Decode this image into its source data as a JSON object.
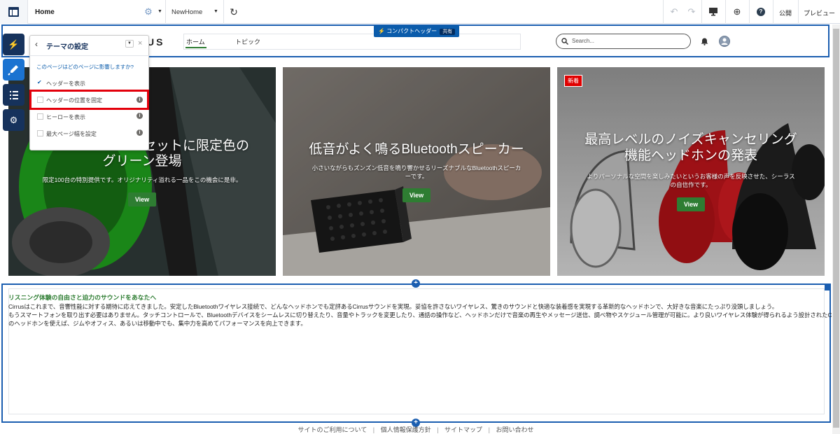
{
  "topbar": {
    "page_name": "Home",
    "page_select": "NewHome",
    "publish": "公開",
    "preview": "プレビュー"
  },
  "header_badge": {
    "label": "コンパクトヘッダー",
    "tag": "共有"
  },
  "site_header": {
    "logo_partial": "US",
    "nav": [
      "ホーム",
      "トピック"
    ],
    "search_placeholder": "Search..."
  },
  "theme_panel": {
    "title": "テーマの設定",
    "question": "このページはどのページに影響しますか?",
    "options": [
      {
        "label": "ヘッダーを表示",
        "checked": true
      },
      {
        "label": "ヘッダーの位置を固定",
        "checked": false
      },
      {
        "label": "ヒーローを表示",
        "checked": false
      },
      {
        "label": "最大ページ幅を設定",
        "checked": false
      }
    ]
  },
  "tiles": [
    {
      "title_l1": "セットに限定色の",
      "title_l2": "グリーン登場",
      "desc": "限定100台の特別提供です。オリジナリティ溢れる一品をこの機会に是非。",
      "button": "View"
    },
    {
      "title_l1": "低音がよく鳴るBluetoothスピーカー",
      "desc_l1": "小さいながらもズンズン低音を鳴り響かせるリーズナブルなBluetoothスピーカ",
      "desc_l2": "ーです。",
      "button": "View"
    },
    {
      "badge": "新着",
      "title_l1": "最高レベルのノイズキャンセリング",
      "title_l2": "機能ヘッドホンの発表",
      "desc_l1": "よりパーソナルな空間を楽しみたいというお客様の声を反映させた、シーラス",
      "desc_l2": "の自信作です。",
      "button": "View"
    }
  ],
  "text_section": {
    "heading": "リスニング体験の自由さと迫力のサウンドをあなたへ",
    "line1": "Cirrusはこれまで、音響性能に対する期待に応えてきました。安定したBluetoothワイヤレス接続で、どんなヘッドホンでも定評あるCirrusサウンドを実現。妥協を許さないワイヤレス、驚きのサウンドと快適な装着感を実現する革新的なヘッドホンで、大好きな音楽にたっぷり没頭しましょう。",
    "line2": "もうスマートフォンを取り出す必要はありません。タッチコントロールで、Bluetoothデバイスをシームレスに切り替えたり、音量やトラックを変更したり、通話の操作など、ヘッドホンだけで音楽の再生やメッセージ送信、調べ物やスケジュール管理が可能に。より良いワイヤレス体験が得られるよう設計されたCirrus",
    "line3": "のヘッドホンを使えば、ジムやオフィス、あるいは移動中でも、集中力を高めてパフォーマンスを向上できます。"
  },
  "footer": {
    "links": [
      "サイトのご利用について",
      "個人情報保護方針",
      "サイトマップ",
      "お問い合わせ"
    ],
    "sep": "|"
  }
}
